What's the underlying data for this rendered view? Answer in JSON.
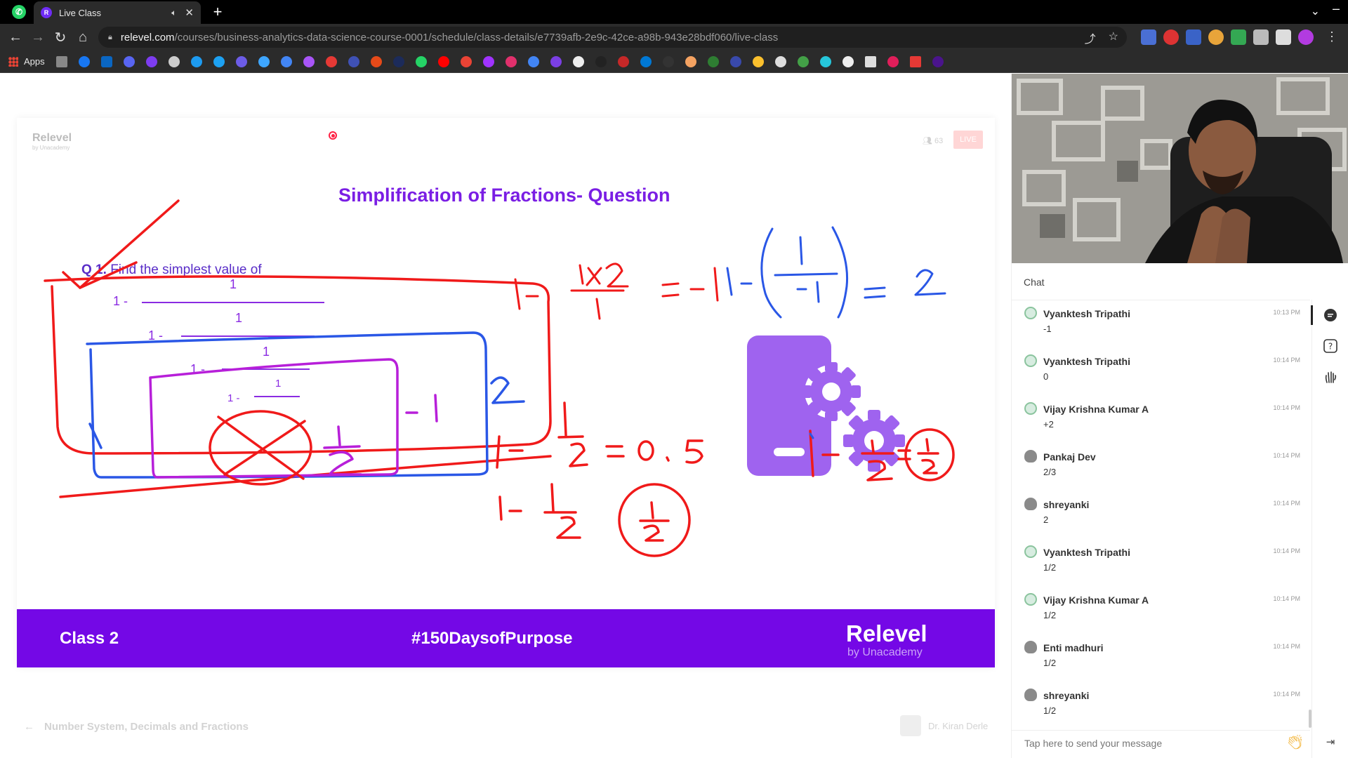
{
  "browser": {
    "tab_title": "Live Class",
    "url_host": "relevel.com",
    "url_path": "/courses/business-analytics-data-science-course-0001/schedule/class-details/e7739afb-2e9c-42ce-a98b-943e28bdf060/live-class",
    "bookmarks_apps_label": "Apps"
  },
  "slide": {
    "brand": "Relevel",
    "brand_sub": "by Unacademy",
    "viewers": "63",
    "live_label": "LIVE",
    "title": "Simplification of Fractions- Question",
    "question_num": "Q 1.",
    "question_text": "Find the simplest value of",
    "frac_one": "1",
    "frac_prefix": "1 -",
    "footer_class": "Class 2",
    "footer_hashtag": "#150DaysofPurpose",
    "footer_brand": "Relevel",
    "footer_brand_sub": "by Unacademy"
  },
  "lesson": {
    "breadcrumb": "Number System, Decimals and Fractions",
    "teacher": "Dr. Kiran Derle"
  },
  "chat": {
    "title": "Chat",
    "input_placeholder": "Tap here to send your message",
    "messages": [
      {
        "name": "Vyanktesh Tripathi",
        "time": "10:13 PM",
        "text": "-1"
      },
      {
        "name": "Vyanktesh Tripathi",
        "time": "10:14 PM",
        "text": "0"
      },
      {
        "name": "Vijay Krishna Kumar A",
        "time": "10:14 PM",
        "text": "+2"
      },
      {
        "name": "Pankaj Dev",
        "time": "10:14 PM",
        "text": "2/3"
      },
      {
        "name": "shreyanki",
        "time": "10:14 PM",
        "text": "2"
      },
      {
        "name": "Vyanktesh Tripathi",
        "time": "10:14 PM",
        "text": "1/2"
      },
      {
        "name": "Vijay Krishna Kumar A",
        "time": "10:14 PM",
        "text": "1/2"
      },
      {
        "name": "Enti madhuri",
        "time": "10:14 PM",
        "text": "1/2"
      },
      {
        "name": "shreyanki",
        "time": "10:14 PM",
        "text": "1/2"
      }
    ]
  },
  "colors": {
    "brand_purple": "#7408e6",
    "title_purple": "#7a1ee4",
    "ink_red": "#f01a1a",
    "ink_blue": "#2a57e6",
    "ink_magenta": "#b71fd9"
  }
}
